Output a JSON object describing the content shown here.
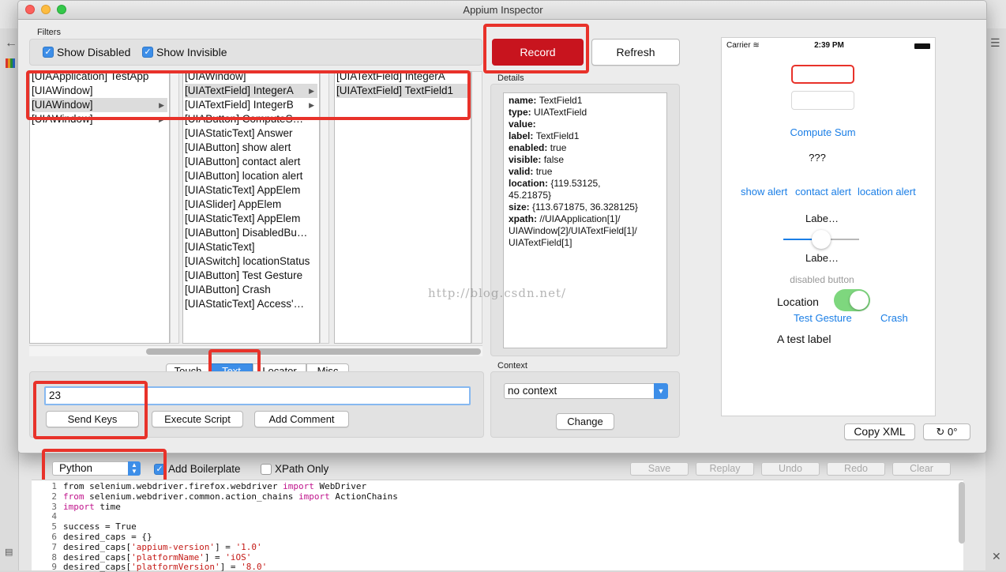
{
  "window": {
    "title": "Appium Inspector"
  },
  "filters": {
    "group_label": "Filters",
    "show_disabled": {
      "label": "Show Disabled",
      "checked": true
    },
    "show_invisible": {
      "label": "Show Invisible",
      "checked": true
    }
  },
  "toolbar": {
    "record_label": "Record",
    "refresh_label": "Refresh"
  },
  "tree": {
    "col1": [
      {
        "label": "[UIAApplication] TestApp",
        "selected": false,
        "arrow": false
      },
      {
        "label": "[UIAWindow]",
        "selected": false,
        "arrow": false
      },
      {
        "label": "[UIAWindow]",
        "selected": true,
        "arrow": true
      },
      {
        "label": "[UIAWindow]",
        "selected": false,
        "arrow": true
      }
    ],
    "col2": [
      {
        "label": "[UIAWindow]",
        "selected": false,
        "arrow": false
      },
      {
        "label": "[UIATextField] IntegerA",
        "selected": true,
        "arrow": true
      },
      {
        "label": "[UIATextField] IntegerB",
        "selected": false,
        "arrow": true
      },
      {
        "label": "[UIAButton] ComputeS…",
        "selected": false,
        "arrow": false
      },
      {
        "label": "[UIAStaticText] Answer",
        "selected": false,
        "arrow": false
      },
      {
        "label": "[UIAButton] show alert",
        "selected": false,
        "arrow": false
      },
      {
        "label": "[UIAButton] contact alert",
        "selected": false,
        "arrow": false
      },
      {
        "label": "[UIAButton] location alert",
        "selected": false,
        "arrow": false
      },
      {
        "label": "[UIAStaticText] AppElem",
        "selected": false,
        "arrow": false
      },
      {
        "label": "[UIASlider] AppElem",
        "selected": false,
        "arrow": false
      },
      {
        "label": "[UIAStaticText] AppElem",
        "selected": false,
        "arrow": false
      },
      {
        "label": "[UIAButton] DisabledBu…",
        "selected": false,
        "arrow": false
      },
      {
        "label": "[UIAStaticText]",
        "selected": false,
        "arrow": false
      },
      {
        "label": "[UIASwitch] locationStatus",
        "selected": false,
        "arrow": false
      },
      {
        "label": "[UIAButton] Test Gesture",
        "selected": false,
        "arrow": false
      },
      {
        "label": "[UIAButton] Crash",
        "selected": false,
        "arrow": false
      },
      {
        "label": "[UIAStaticText] Access'…",
        "selected": false,
        "arrow": false
      }
    ],
    "col3": [
      {
        "label": "[UIATextField] IntegerA",
        "selected": false,
        "arrow": false
      },
      {
        "label": "[UIATextField] TextField1",
        "selected": true,
        "arrow": false
      }
    ]
  },
  "details": {
    "group_label": "Details",
    "lines": [
      {
        "key": "name:",
        "value": "TextField1"
      },
      {
        "key": "type:",
        "value": "UIATextField"
      },
      {
        "key": "value:",
        "value": ""
      },
      {
        "key": "label:",
        "value": "TextField1"
      },
      {
        "key": "enabled:",
        "value": "true"
      },
      {
        "key": "visible:",
        "value": "false"
      },
      {
        "key": "valid:",
        "value": "true"
      },
      {
        "key": "location:",
        "value": "{119.53125,"
      },
      {
        "key": "",
        "value": "45.21875}"
      },
      {
        "key": "size:",
        "value": "{113.671875, 36.328125}"
      },
      {
        "key": "xpath:",
        "value": "//UIAApplication[1]/"
      },
      {
        "key": "",
        "value": "UIAWindow[2]/UIATextField[1]/"
      },
      {
        "key": "",
        "value": "UIATextField[1]"
      }
    ]
  },
  "tabs": [
    "Touch",
    "Text",
    "Locator",
    "Misc"
  ],
  "active_tab": "Text",
  "text_panel": {
    "input_value": "23",
    "send_keys": "Send Keys",
    "execute_script": "Execute Script",
    "add_comment": "Add Comment"
  },
  "context": {
    "group_label": "Context",
    "selected": "no context",
    "change_label": "Change"
  },
  "device": {
    "carrier": "Carrier",
    "time": "2:39 PM",
    "compute_sum": "Compute Sum",
    "answer": "???",
    "show_alert": "show alert",
    "contact_alert": "contact alert",
    "location_alert": "location alert",
    "slider_label_top": "Labe…",
    "slider_label_bottom": "Labe…",
    "slider_value": 0.5,
    "disabled_button": "disabled button",
    "location_label": "Location",
    "location_on": true,
    "test_gesture": "Test Gesture",
    "crash": "Crash",
    "test_label": "A test label"
  },
  "bottom_right": {
    "copy_xml": "Copy XML",
    "rotation": "0°"
  },
  "watermark": "http://blog.csdn.net/",
  "editor": {
    "language": "Python",
    "add_boilerplate": {
      "label": "Add Boilerplate",
      "checked": true
    },
    "xpath_only": {
      "label": "XPath Only",
      "checked": false
    },
    "actions": [
      "Save",
      "Replay",
      "Undo",
      "Redo",
      "Clear"
    ],
    "code": [
      {
        "n": "1",
        "parts": [
          {
            "t": "from selenium.webdriver.firefox.webdriver ",
            "c": ""
          },
          {
            "t": "import",
            "c": "kw"
          },
          {
            "t": " WebDriver",
            "c": ""
          }
        ]
      },
      {
        "n": "2",
        "parts": [
          {
            "t": "from",
            "c": "kw"
          },
          {
            "t": " selenium.webdriver.common.action_chains ",
            "c": ""
          },
          {
            "t": "import",
            "c": "kw"
          },
          {
            "t": " ActionChains",
            "c": ""
          }
        ]
      },
      {
        "n": "3",
        "parts": [
          {
            "t": "import",
            "c": "kw"
          },
          {
            "t": " time",
            "c": ""
          }
        ]
      },
      {
        "n": "4",
        "parts": []
      },
      {
        "n": "5",
        "parts": [
          {
            "t": "success = True",
            "c": ""
          }
        ]
      },
      {
        "n": "6",
        "parts": [
          {
            "t": "desired_caps = {}",
            "c": ""
          }
        ]
      },
      {
        "n": "7",
        "parts": [
          {
            "t": "desired_caps[",
            "c": ""
          },
          {
            "t": "'appium-version'",
            "c": "str"
          },
          {
            "t": "] = ",
            "c": ""
          },
          {
            "t": "'1.0'",
            "c": "str"
          }
        ]
      },
      {
        "n": "8",
        "parts": [
          {
            "t": "desired_caps[",
            "c": ""
          },
          {
            "t": "'platformName'",
            "c": "str"
          },
          {
            "t": "] = ",
            "c": ""
          },
          {
            "t": "'iOS'",
            "c": "str"
          }
        ]
      },
      {
        "n": "9",
        "parts": [
          {
            "t": "desired_caps[",
            "c": ""
          },
          {
            "t": "'platformVersion'",
            "c": "str"
          },
          {
            "t": "] = ",
            "c": ""
          },
          {
            "t": "'8.0'",
            "c": "str"
          }
        ]
      }
    ]
  },
  "colors": {
    "record": "#c8141e",
    "highlight": "#e8322a",
    "link": "#1a7ee6",
    "check": "#3d8ee8",
    "switch_on": "#7ed77e"
  }
}
